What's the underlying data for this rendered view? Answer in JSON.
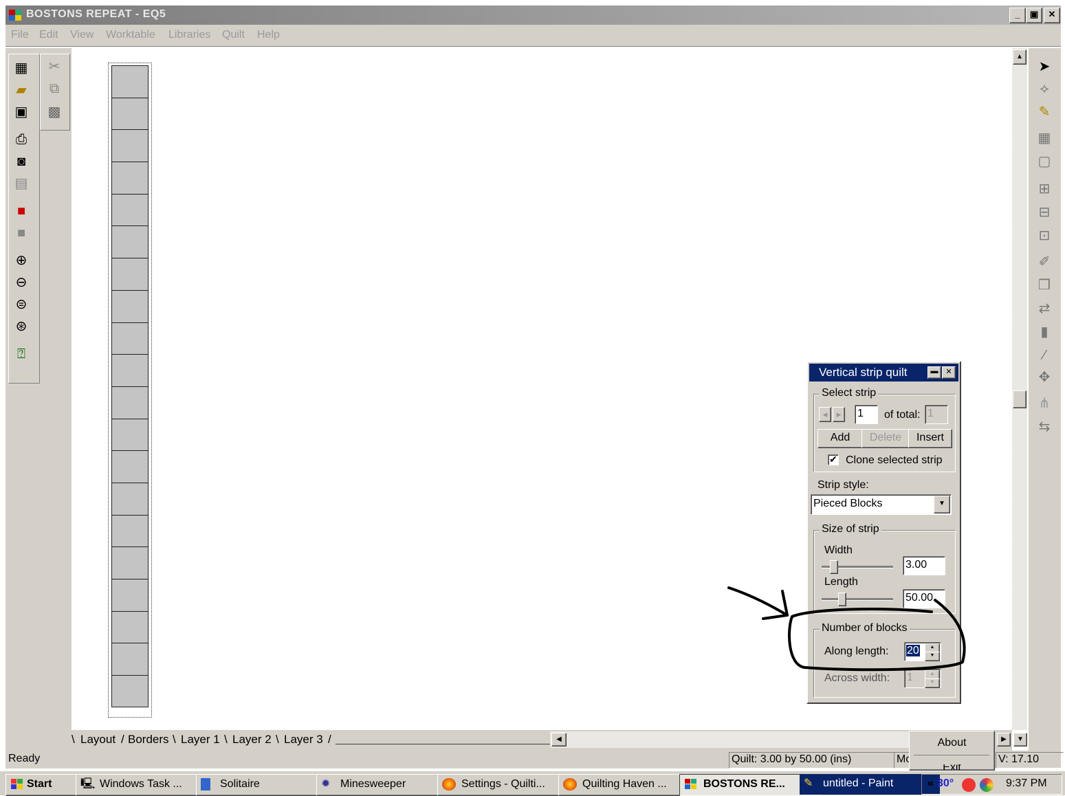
{
  "window": {
    "title": "BOSTONS REPEAT - EQ5",
    "minimize": "_",
    "maximize": "▣",
    "close": "✕"
  },
  "menu": [
    "File",
    "Edit",
    "View",
    "Worktable",
    "Libraries",
    "Quilt",
    "Help"
  ],
  "quilt": {
    "block_count": 20,
    "block_color": "#c4c4c4"
  },
  "tabs": [
    "Layout",
    "Borders",
    "Layer 1",
    "Layer 2",
    "Layer 3"
  ],
  "status": {
    "left": "Ready",
    "quilt": "Quilt:   3.00 by 50.00 (ins)",
    "mode": "Mo",
    "v": "V:  17.10"
  },
  "popup": {
    "about": "About",
    "exit": "Exit"
  },
  "dialog": {
    "title": "Vertical strip quilt",
    "select_strip": {
      "label": "Select strip",
      "strip_value": "1",
      "of_total_label": "of total:",
      "total_value": "1",
      "add": "Add",
      "delete": "Delete",
      "insert": "Insert",
      "clone_label": "Clone selected strip",
      "clone_checked": true
    },
    "strip_style": {
      "label": "Strip style:",
      "value": "Pieced Blocks"
    },
    "size": {
      "label": "Size of strip",
      "width_label": "Width",
      "width_value": "3.00",
      "length_label": "Length",
      "length_value": "50.00"
    },
    "blocks": {
      "label": "Number of blocks",
      "along_label": "Along length:",
      "along_value": "20",
      "across_label": "Across width:",
      "across_value": "1"
    }
  },
  "taskbar": {
    "start": "Start",
    "tasks": [
      "Windows Task ...",
      "Solitaire",
      "Minesweeper",
      "Settings - Quilti...",
      "Quilting Haven ...",
      "BOSTONS RE...",
      "untitled - Paint"
    ],
    "tray_arrows": "«",
    "tray_temp": "30°",
    "clock": "9:37 PM"
  }
}
